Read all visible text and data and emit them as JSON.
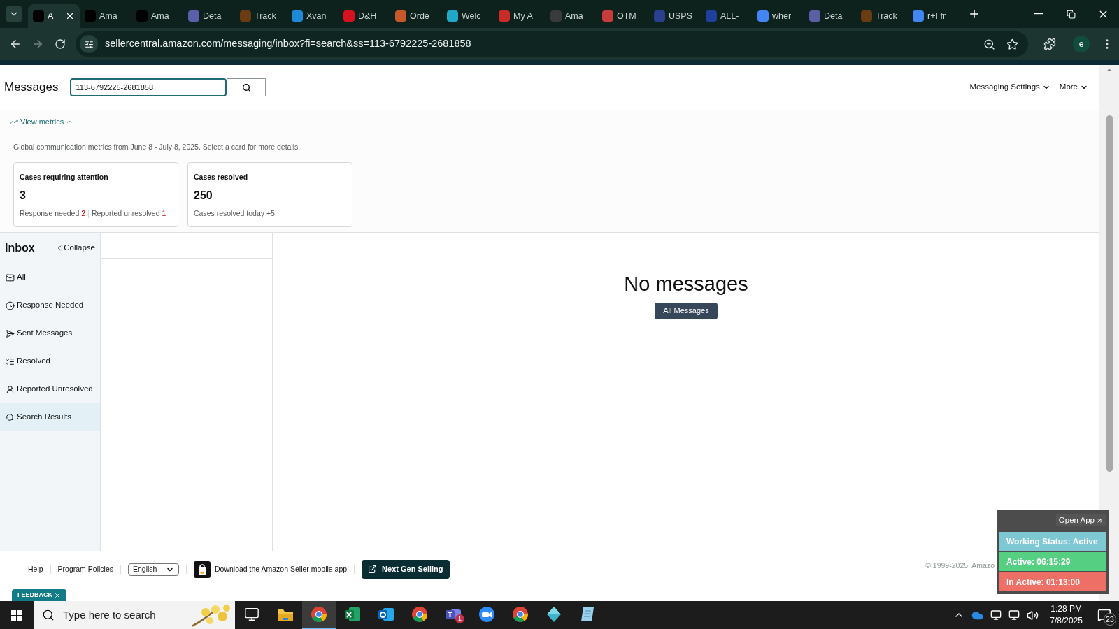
{
  "browser": {
    "tabs": [
      {
        "label": "A",
        "selected": true,
        "color": "#000000"
      },
      {
        "label": "Ama",
        "selected": false,
        "color": "#000000"
      },
      {
        "label": "Ama",
        "selected": false,
        "color": "#000000"
      },
      {
        "label": "Deta",
        "selected": false,
        "color": "#5b5fa8"
      },
      {
        "label": "Track",
        "selected": false,
        "color": "#6b3b12"
      },
      {
        "label": "Xvan",
        "selected": false,
        "color": "#1c8ad6"
      },
      {
        "label": "D&H",
        "selected": false,
        "color": "#d5121e"
      },
      {
        "label": "Orde",
        "selected": false,
        "color": "#c8572a"
      },
      {
        "label": "Welc",
        "selected": false,
        "color": "#20a8c7"
      },
      {
        "label": "My A",
        "selected": false,
        "color": "#c92a2a"
      },
      {
        "label": "Ama",
        "selected": false,
        "color": "#3a3a3a"
      },
      {
        "label": "OTM",
        "selected": false,
        "color": "#c93c3c"
      },
      {
        "label": "USPS",
        "selected": false,
        "color": "#2a3f8f"
      },
      {
        "label": "ALL-",
        "selected": false,
        "color": "#1e3f9e"
      },
      {
        "label": "wher",
        "selected": false,
        "color": "#4285f4"
      },
      {
        "label": "Deta",
        "selected": false,
        "color": "#5b5fa8"
      },
      {
        "label": "Track",
        "selected": false,
        "color": "#6b3b12"
      },
      {
        "label": "r+I fr",
        "selected": false,
        "color": "#4285f4"
      }
    ],
    "url": "sellercentral.amazon.com/messaging/inbox?fi=search&ss=113-6792225-2681858",
    "profile": "e"
  },
  "header": {
    "title": "Messages",
    "search_value": "113-6792225-2681858",
    "menus": [
      "Messaging Settings",
      "More"
    ]
  },
  "metrics": {
    "toggle": "View metrics",
    "expanded": true,
    "summary": "Global communication metrics from June 8 - July 8, 2025. Select a card for more details.",
    "cards": [
      {
        "title": "Cases requiring attention",
        "value": "3",
        "details": [
          {
            "label": "Response needed",
            "count": "2",
            "alert": true
          },
          {
            "label": "Reported unresolved",
            "count": "1",
            "alert": true
          }
        ]
      },
      {
        "title": "Cases resolved",
        "value": "250",
        "details": [
          {
            "label": "Cases resolved today",
            "count": "+5",
            "alert": false
          }
        ]
      }
    ]
  },
  "inbox": {
    "title": "Inbox",
    "collapse": "Collapse",
    "items": [
      {
        "label": "All",
        "kind": "mail",
        "selected": false
      },
      {
        "label": "Response Needed",
        "kind": "clock",
        "selected": false
      },
      {
        "label": "Sent Messages",
        "kind": "send",
        "selected": false
      },
      {
        "label": "Resolved",
        "kind": "resolved",
        "selected": false
      },
      {
        "label": "Reported Unresolved",
        "kind": "reported",
        "selected": false
      },
      {
        "label": "Search Results",
        "kind": "search",
        "selected": true
      }
    ]
  },
  "empty_state": {
    "title": "No messages",
    "button": "All Messages"
  },
  "footer": {
    "links": [
      "Help",
      "Program Policies"
    ],
    "language": "English",
    "app_promo": "Download the Amazon Seller mobile app",
    "next_gen": "Next Gen Selling",
    "copyright": "© 1999-2025, Amazo"
  },
  "feedback": "FEEDBACK",
  "status_widget": {
    "open_app": "Open App",
    "rows": [
      {
        "text": "Working Status: Active",
        "color": "#7ec8d4"
      },
      {
        "text": "Active: 06:15:29",
        "color": "#55d083"
      },
      {
        "text": "In Active: 01:13:00",
        "color": "#ee6f66"
      }
    ]
  },
  "taskbar": {
    "search_placeholder": "Type here to search",
    "apps": [
      {
        "kind": "task-view",
        "selected": false
      },
      {
        "kind": "folder",
        "selected": false
      },
      {
        "kind": "chrome",
        "selected": true
      },
      {
        "kind": "excel",
        "selected": false
      },
      {
        "kind": "outlook",
        "selected": false
      },
      {
        "kind": "chrome",
        "selected": false
      },
      {
        "kind": "teams",
        "selected": false,
        "badge": "1"
      },
      {
        "kind": "zoom",
        "selected": false
      },
      {
        "kind": "chrome",
        "selected": false
      },
      {
        "kind": "diamond",
        "selected": false
      },
      {
        "kind": "notepad",
        "selected": false
      }
    ],
    "time": "1:28 PM",
    "date": "7/8/2025",
    "notifications": "23"
  }
}
